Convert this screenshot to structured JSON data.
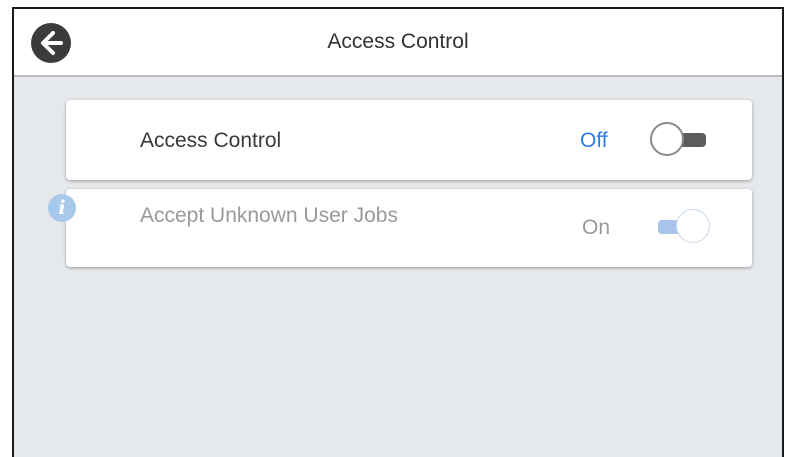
{
  "header": {
    "title": "Access Control",
    "back_icon": "arrow-left-icon"
  },
  "settings": [
    {
      "label": "Access Control",
      "value": "Off",
      "toggle_state": "off",
      "enabled": true
    },
    {
      "label": "Accept Unknown User Jobs",
      "value": "On",
      "toggle_state": "on",
      "enabled": false,
      "info_icon": "i"
    }
  ],
  "colors": {
    "accent_blue": "#2f7de0",
    "disabled_text": "#9a9a9a",
    "background": "#e6e9ec"
  }
}
